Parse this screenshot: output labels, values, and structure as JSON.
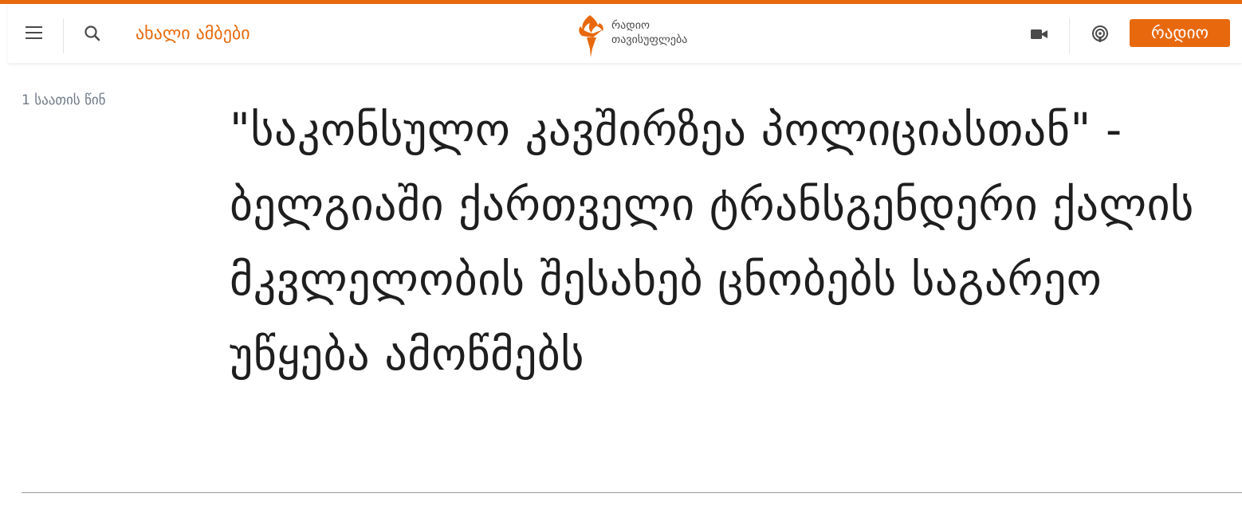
{
  "colors": {
    "accent": "#e8690d",
    "text": "#1e1e1e",
    "muted": "#707a87",
    "icon": "#4a4a4a"
  },
  "header": {
    "menu_icon": "hamburger-menu-icon",
    "search_icon": "search-icon",
    "nav_latest": "ახალი ამბები",
    "logo": {
      "icon": "torch-flame-logo-icon",
      "line1": "რადიო",
      "line2": "თავისუფლება"
    },
    "video_icon": "video-camera-icon",
    "podcast_icon": "podcast-icon",
    "radio_button": "რადიო"
  },
  "article": {
    "timestamp": "1 საათის წინ",
    "headline": "\"საკონსულო კავშირზეა პოლიციასთან\" - ბელგიაში ქართველი ტრანსგენდერი ქალის მკვლელობის შესახებ ცნობებს საგარეო უწყება ამოწმებს"
  }
}
